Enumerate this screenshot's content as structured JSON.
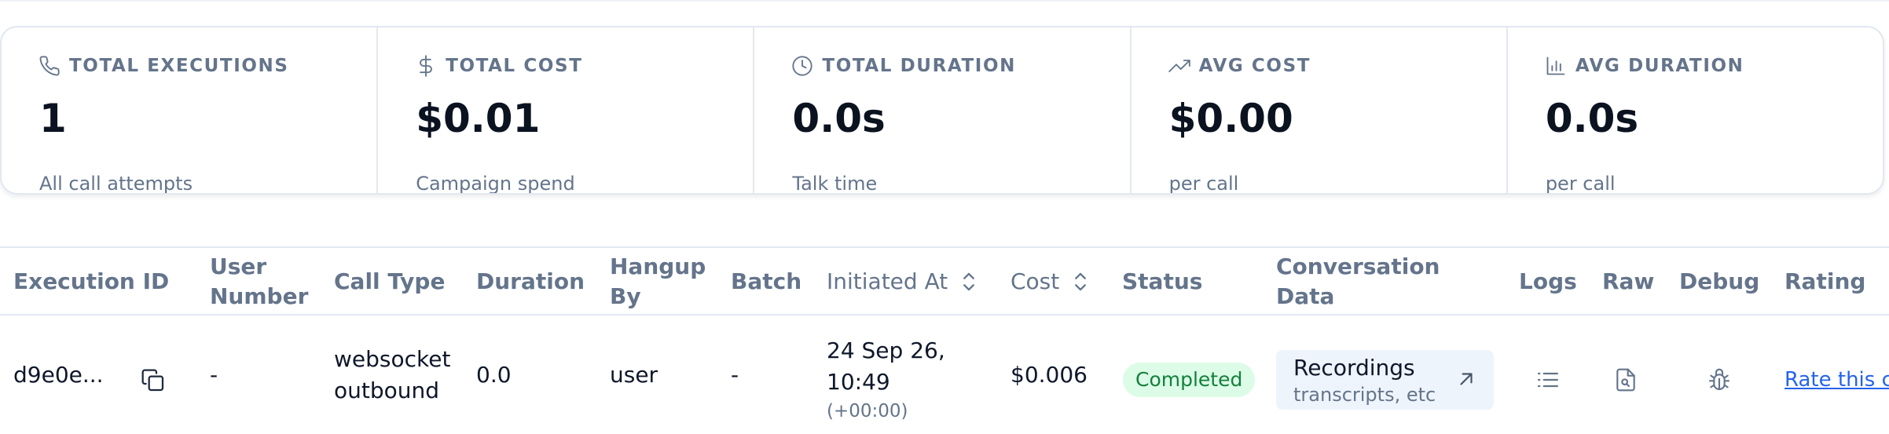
{
  "stats": [
    {
      "icon": "phone-icon",
      "label": "TOTAL EXECUTIONS",
      "value": "1",
      "sub": "All call attempts"
    },
    {
      "icon": "dollar-icon",
      "label": "TOTAL COST",
      "value": "$0.01",
      "sub": "Campaign spend"
    },
    {
      "icon": "clock-icon",
      "label": "TOTAL DURATION",
      "value": "0.0s",
      "sub": "Talk time"
    },
    {
      "icon": "trending-up-icon",
      "label": "AVG COST",
      "value": "$0.00",
      "sub": "per call"
    },
    {
      "icon": "bar-chart-icon",
      "label": "AVG DURATION",
      "value": "0.0s",
      "sub": "per call"
    }
  ],
  "table": {
    "headers": {
      "execution_id": "Execution ID",
      "user_number": "User Number",
      "call_type": "Call Type",
      "duration": "Duration",
      "hangup_by": "Hangup By",
      "batch": "Batch",
      "initiated_at": "Initiated At",
      "cost": "Cost",
      "status": "Status",
      "conversation_data": "Conversation Data",
      "logs": "Logs",
      "raw": "Raw",
      "debug": "Debug",
      "rating": "Rating"
    },
    "rows": [
      {
        "execution_id": "d9e0e...",
        "user_number": "-",
        "call_type": "websocket outbound",
        "duration": "0.0",
        "hangup_by": "user",
        "batch": "-",
        "initiated_at": "24 Sep 26, 10:49",
        "timezone": "(+00:00)",
        "cost": "$0.006",
        "status": "Completed",
        "conversation_title": "Recordings",
        "conversation_sub": "transcripts, etc",
        "rating_link": "Rate this c"
      }
    ]
  },
  "colors": {
    "status_bg": "#dcfce7",
    "status_text": "#15803d",
    "link": "#2563eb",
    "muted": "#64748b"
  }
}
